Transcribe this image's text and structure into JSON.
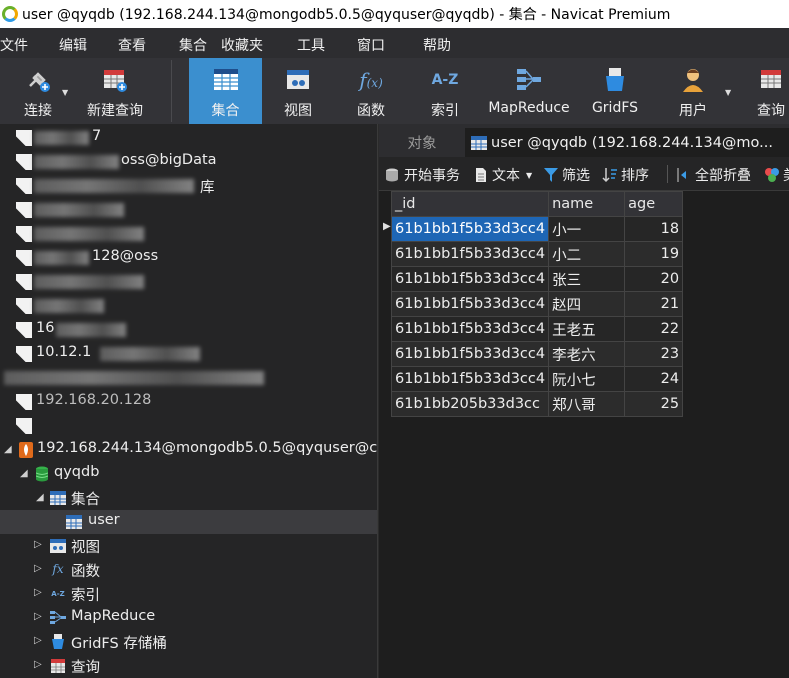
{
  "window": {
    "title": "user @qyqdb (192.168.244.134@mongodb5.0.5@qyquser@qyqdb) - 集合 - Navicat Premium"
  },
  "menu": [
    "文件",
    "编辑",
    "查看",
    "集合",
    "收藏夹",
    "工具",
    "窗口",
    "帮助"
  ],
  "toolbar": {
    "connect": "连接",
    "new_query": "新建查询",
    "collection": "集合",
    "view": "视图",
    "function": "函数",
    "index": "索引",
    "mapreduce": "MapReduce",
    "gridfs": "GridFS",
    "user": "用户",
    "query": "查询"
  },
  "nav": {
    "connections_visible": [
      "7",
      "oss@bigData",
      "库",
      "",
      "",
      "128@oss",
      "",
      "",
      "16",
      "10.12.1",
      "",
      "192.168.20.128",
      ""
    ],
    "mongo_connection": "192.168.244.134@mongodb5.0.5@qyquser@c",
    "database": "qyqdb",
    "collections_folder": "集合",
    "collection_user": "user",
    "views_folder": "视图",
    "functions_folder": "函数",
    "indexes_folder": "索引",
    "mapreduce_folder": "MapReduce",
    "gridfs_folder": "GridFS 存储桶",
    "queries_folder": "查询"
  },
  "tabs": {
    "objects": "对象",
    "user_tab": "user @qyqdb (192.168.244.134@mo..."
  },
  "table_toolbar": {
    "begin_transaction": "开始事务",
    "text": "文本",
    "filter": "筛选",
    "sort": "排序",
    "collapse_all": "全部折叠",
    "more": "美"
  },
  "table": {
    "columns": [
      "_id",
      "name",
      "age"
    ],
    "rows": [
      {
        "id": "61b1bb1f5b33d3cc4",
        "name": "小一",
        "age": "18"
      },
      {
        "id": "61b1bb1f5b33d3cc4",
        "name": "小二",
        "age": "19"
      },
      {
        "id": "61b1bb1f5b33d3cc4",
        "name": "张三",
        "age": "20"
      },
      {
        "id": "61b1bb1f5b33d3cc4",
        "name": "赵四",
        "age": "21"
      },
      {
        "id": "61b1bb1f5b33d3cc4",
        "name": "王老五",
        "age": "22"
      },
      {
        "id": "61b1bb1f5b33d3cc4",
        "name": "李老六",
        "age": "23"
      },
      {
        "id": "61b1bb1f5b33d3cc4",
        "name": "阮小七",
        "age": "24"
      },
      {
        "id": "61b1bb205b33d3cc",
        "name": "郑八哥",
        "age": "25"
      }
    ]
  },
  "colors": {
    "accent": "#3b8fcf",
    "selection": "#1e66b5",
    "background": "#1e1e1e"
  }
}
